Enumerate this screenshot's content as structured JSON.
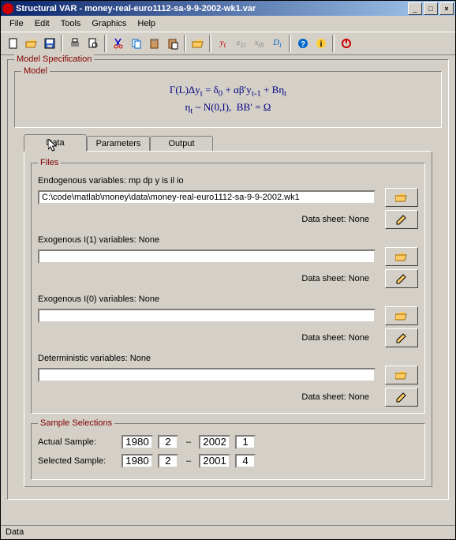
{
  "title": "Structural VAR - money-real-euro1112-sa-9-9-2002-wk1.var",
  "menu": {
    "file": "File",
    "edit": "Edit",
    "tools": "Tools",
    "graphics": "Graphics",
    "help": "Help"
  },
  "modelspec": {
    "legend": "Model Specification",
    "model_legend": "Model",
    "eq1": "Γ(L)Δy_t = δ_0 + αβ′y_{t-1} + Bη_t",
    "eq2": "η_t ~ N(0,I),   BB′ = Ω"
  },
  "tabs": {
    "data": "Data",
    "parameters": "Parameters",
    "output": "Output"
  },
  "files": {
    "legend": "Files",
    "endo_label": "Endogenous variables:  mp dp y is il io",
    "endo_value": "C:\\code\\matlab\\money\\data\\money-real-euro1112-sa-9-9-2002.wk1",
    "endo_sheet": "Data sheet: None",
    "exo1_label": "Exogenous I(1) variables:  None",
    "exo1_value": "",
    "exo1_sheet": "Data sheet: None",
    "exo0_label": "Exogenous I(0) variables:  None",
    "exo0_value": "",
    "exo0_sheet": "Data sheet: None",
    "det_label": "Deterministic variables:  None",
    "det_value": "",
    "det_sheet": "Data sheet: None"
  },
  "sample": {
    "legend": "Sample Selections",
    "actual_label": "Actual Sample:",
    "actual": [
      "1980",
      "2",
      "2002",
      "1"
    ],
    "selected_label": "Selected Sample:",
    "selected": [
      "1980",
      "2",
      "2001",
      "4"
    ]
  },
  "status": "Data"
}
